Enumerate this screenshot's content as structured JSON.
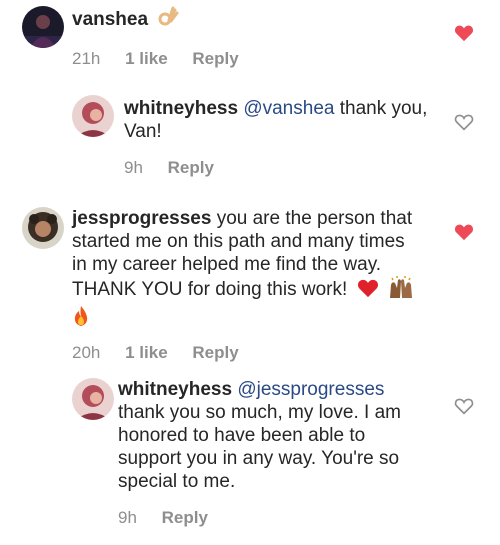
{
  "colors": {
    "text": "#262626",
    "meta": "#8e8e8e",
    "mention": "#2a4a86",
    "heart_liked": "#ed4956",
    "heart_outline": "#8e8e8e"
  },
  "comments": [
    {
      "username": "vanshea",
      "text_lines": [
        ""
      ],
      "emoji": "ok-hand-emoji",
      "time": "21h",
      "likes": "1 like",
      "reply_label": "Reply",
      "liked": true
    },
    {
      "username": "whitneyhess",
      "mention": "@vanshea",
      "text_first": " thank you,",
      "text_lines": [
        "Van!"
      ],
      "time": "9h",
      "reply_label": "Reply",
      "liked": false
    },
    {
      "username": "jessprogresses",
      "text_first": " you are the person that",
      "text_lines": [
        "started me on this path and many times",
        "in my career helped me find the way.",
        "THANK YOU for doing this work!"
      ],
      "emojis": [
        "red-heart-emoji",
        "raising-hands-emoji",
        "fire-emoji"
      ],
      "time": "20h",
      "likes": "1 like",
      "reply_label": "Reply",
      "liked": true
    },
    {
      "username": "whitneyhess",
      "mention": "@jessprogresses",
      "text_lines": [
        "thank you so much, my love. I am",
        "honored to have been able to",
        "support you in any way. You're so",
        "special to me."
      ],
      "time": "9h",
      "reply_label": "Reply",
      "liked": false
    }
  ]
}
